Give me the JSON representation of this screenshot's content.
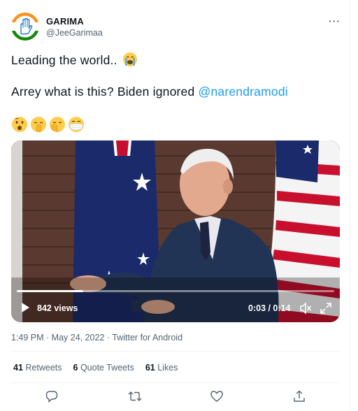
{
  "author": {
    "name": "GARIMA",
    "handle": "@JeeGarimaa"
  },
  "tweet": {
    "line1": "Leading the world..",
    "line2": "Arrey what is this? Biden ignored ",
    "mention": "@narendramodi",
    "emoji_line1": "crying-emoji",
    "emojis": [
      "zipper-mouth-face-emoji",
      "shushing-face-emoji",
      "yawning-face-emoji",
      "face-with-mask-emoji"
    ]
  },
  "video": {
    "views": "842 views",
    "time": "0:03 / 0:14",
    "progress_fraction": 0.21
  },
  "meta": "1:49 PM · May 24, 2022 · Twitter for Android",
  "stats": {
    "retweets_count": "41",
    "retweets_label": "Retweets",
    "quotes_count": "6",
    "quotes_label": "Quote Tweets",
    "likes_count": "61",
    "likes_label": "Likes"
  },
  "colors": {
    "accent": "#1d9bf0",
    "secondary_text": "#536471",
    "border": "#eff3f4"
  }
}
